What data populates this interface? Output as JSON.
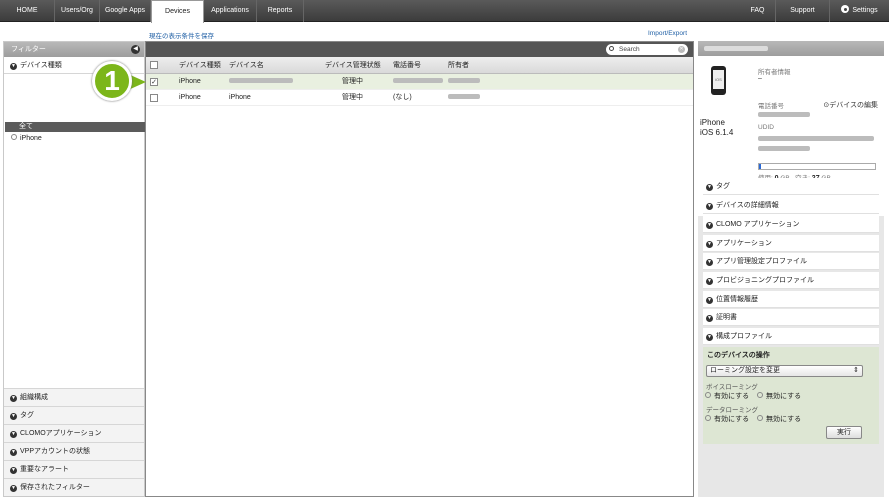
{
  "topnav": {
    "tabs": [
      "HOME",
      "Users/Org",
      "Google Apps",
      "Devices",
      "Applications",
      "Reports"
    ],
    "active_tab": "Devices",
    "right": {
      "faq": "FAQ",
      "support": "Support",
      "settings": "Settings"
    }
  },
  "subbar": {
    "save_view": "現在の表示条件を保存",
    "import_export": "Import/Export"
  },
  "sidebar": {
    "header": "フィルター",
    "device_type_section": "デバイス種類",
    "selected_filter": "全て",
    "filter_option": "iPhone",
    "bottom_sections": [
      "組織構成",
      "タグ",
      "CLOMOアプリケーション",
      "VPPアカウントの状態",
      "重要なアラート",
      "保存されたフィルター"
    ]
  },
  "callout_number": "1",
  "table": {
    "search_placeholder": "Search",
    "columns": [
      "デバイス種類",
      "デバイス名",
      "デバイス管理状態",
      "電話番号",
      "所有者"
    ],
    "rows": [
      {
        "type": "iPhone",
        "name": "",
        "state": "管理中",
        "phone": "",
        "owner": "",
        "checked": true
      },
      {
        "type": "iPhone",
        "name": "iPhone",
        "state": "管理中",
        "phone": "(なし)",
        "owner": "",
        "checked": false
      }
    ]
  },
  "device_panel": {
    "phone_screen_label": "iOS",
    "device_model": "iPhone",
    "device_os": "iOS 6.1.4",
    "owner_info_label": "所有者情報",
    "owner_value": "–",
    "edit_link": "デバイスの編集",
    "phone_number_label": "電話番号",
    "udid_label": "UDID",
    "usage": {
      "used_label": "使用:",
      "used_value": "0",
      "used_unit": "GB",
      "free_label": "空き:",
      "free_value": "27",
      "free_unit": "GB",
      "fraction_used": 0.02
    }
  },
  "accordions": [
    "タグ",
    "デバイスの詳細情報",
    "CLOMO アプリケーション",
    "アプリケーション",
    "アプリ管理設定プロファイル",
    "プロビジョニングプロファイル",
    "位置情報履歴",
    "証明書",
    "構成プロファイル"
  ],
  "operations": {
    "title": "このデバイスの操作",
    "selected_action": "ローミング設定を変更",
    "voice_roaming_label": "ボイスローミング",
    "data_roaming_label": "データローミング",
    "enable": "有効にする",
    "disable": "無効にする",
    "execute": "実行"
  },
  "colors": {
    "accent_green": "#7cb61a",
    "highlight_row": "#e9f0e0",
    "progress_blue": "#2a69d6"
  }
}
